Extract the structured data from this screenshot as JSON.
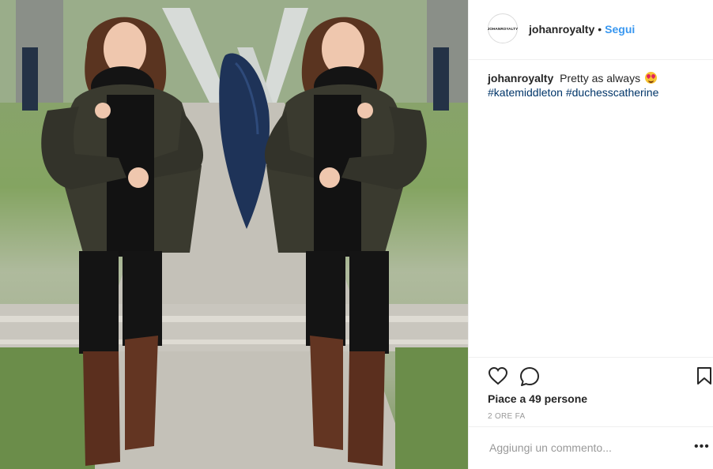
{
  "header": {
    "avatar_text": "JOHANROYALTY",
    "username": "johanroyalty",
    "separator": "•",
    "follow_label": "Segui"
  },
  "caption": {
    "username": "johanroyalty",
    "text": "Pretty as always",
    "emoji": "heart-eyes-emoji",
    "hashtags": [
      "#katemiddleton",
      "#duchesscatherine"
    ]
  },
  "actions": {
    "like_icon": "heart-icon",
    "comment_icon": "comment-icon",
    "save_icon": "bookmark-icon"
  },
  "likes": "Piace a 49 persone",
  "time": "2 ORE FA",
  "comment": {
    "placeholder": "Aggiungi un commento...",
    "more_label": "•••"
  },
  "colors": {
    "accent": "#3897f0",
    "hashtag": "#003569",
    "text": "#262626",
    "muted": "#999999",
    "border": "#efefef"
  }
}
